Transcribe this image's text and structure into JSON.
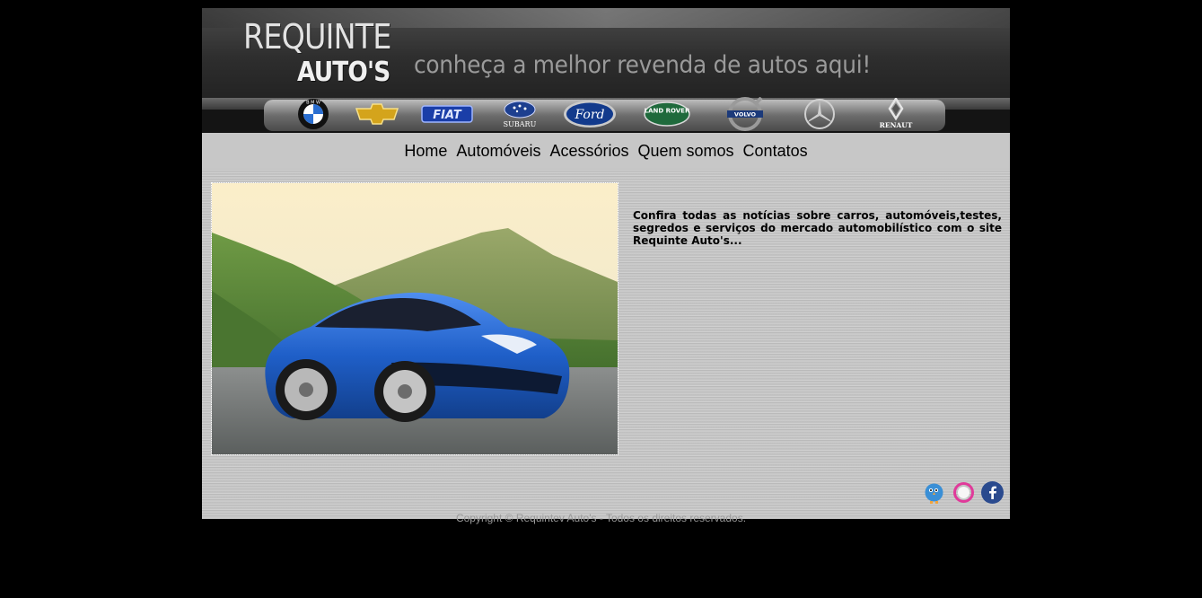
{
  "header": {
    "logo_line1": "REQUINTE",
    "logo_line2": "AUTO'S",
    "tagline": "conheça a melhor revenda de autos aqui!"
  },
  "brands": [
    {
      "name": "BMW",
      "icon": "bmw-logo-icon",
      "label": "B M W"
    },
    {
      "name": "Chevrolet",
      "icon": "chevrolet-logo-icon",
      "label": ""
    },
    {
      "name": "Fiat",
      "icon": "fiat-logo-icon",
      "label": "FIAT"
    },
    {
      "name": "Subaru",
      "icon": "subaru-logo-icon",
      "label": "SUBARU"
    },
    {
      "name": "Ford",
      "icon": "ford-logo-icon",
      "label": "Ford"
    },
    {
      "name": "Land Rover",
      "icon": "land-rover-logo-icon",
      "label": "LAND ROVER"
    },
    {
      "name": "Volvo",
      "icon": "volvo-logo-icon",
      "label": "VOLVO"
    },
    {
      "name": "Mercedes-Benz",
      "icon": "mercedes-logo-icon",
      "label": ""
    },
    {
      "name": "Renault",
      "icon": "renault-logo-icon",
      "label": "RENAUT"
    }
  ],
  "nav": {
    "items": [
      "Home",
      "Automóveis",
      "Acessórios",
      "Quem somos",
      "Contatos"
    ]
  },
  "main": {
    "intro_text": "Confira todas as notícias sobre carros, automóveis,testes, segredos e serviços do mercado automobilístico com o site Requinte Auto's..."
  },
  "social": [
    {
      "icon": "twitter-bird-icon",
      "color": "#3a8fd6"
    },
    {
      "icon": "orkut-icon",
      "color": "#e03a9a"
    },
    {
      "icon": "facebook-icon",
      "color": "#2a4a8e"
    }
  ],
  "footer": {
    "copyright": "Copyright © Requintev Auto's - Todos os direitos reservados."
  },
  "colors": {
    "page_background": "#000000",
    "car_body": "#1f5fc8",
    "content_background": "#c4c4c4"
  }
}
